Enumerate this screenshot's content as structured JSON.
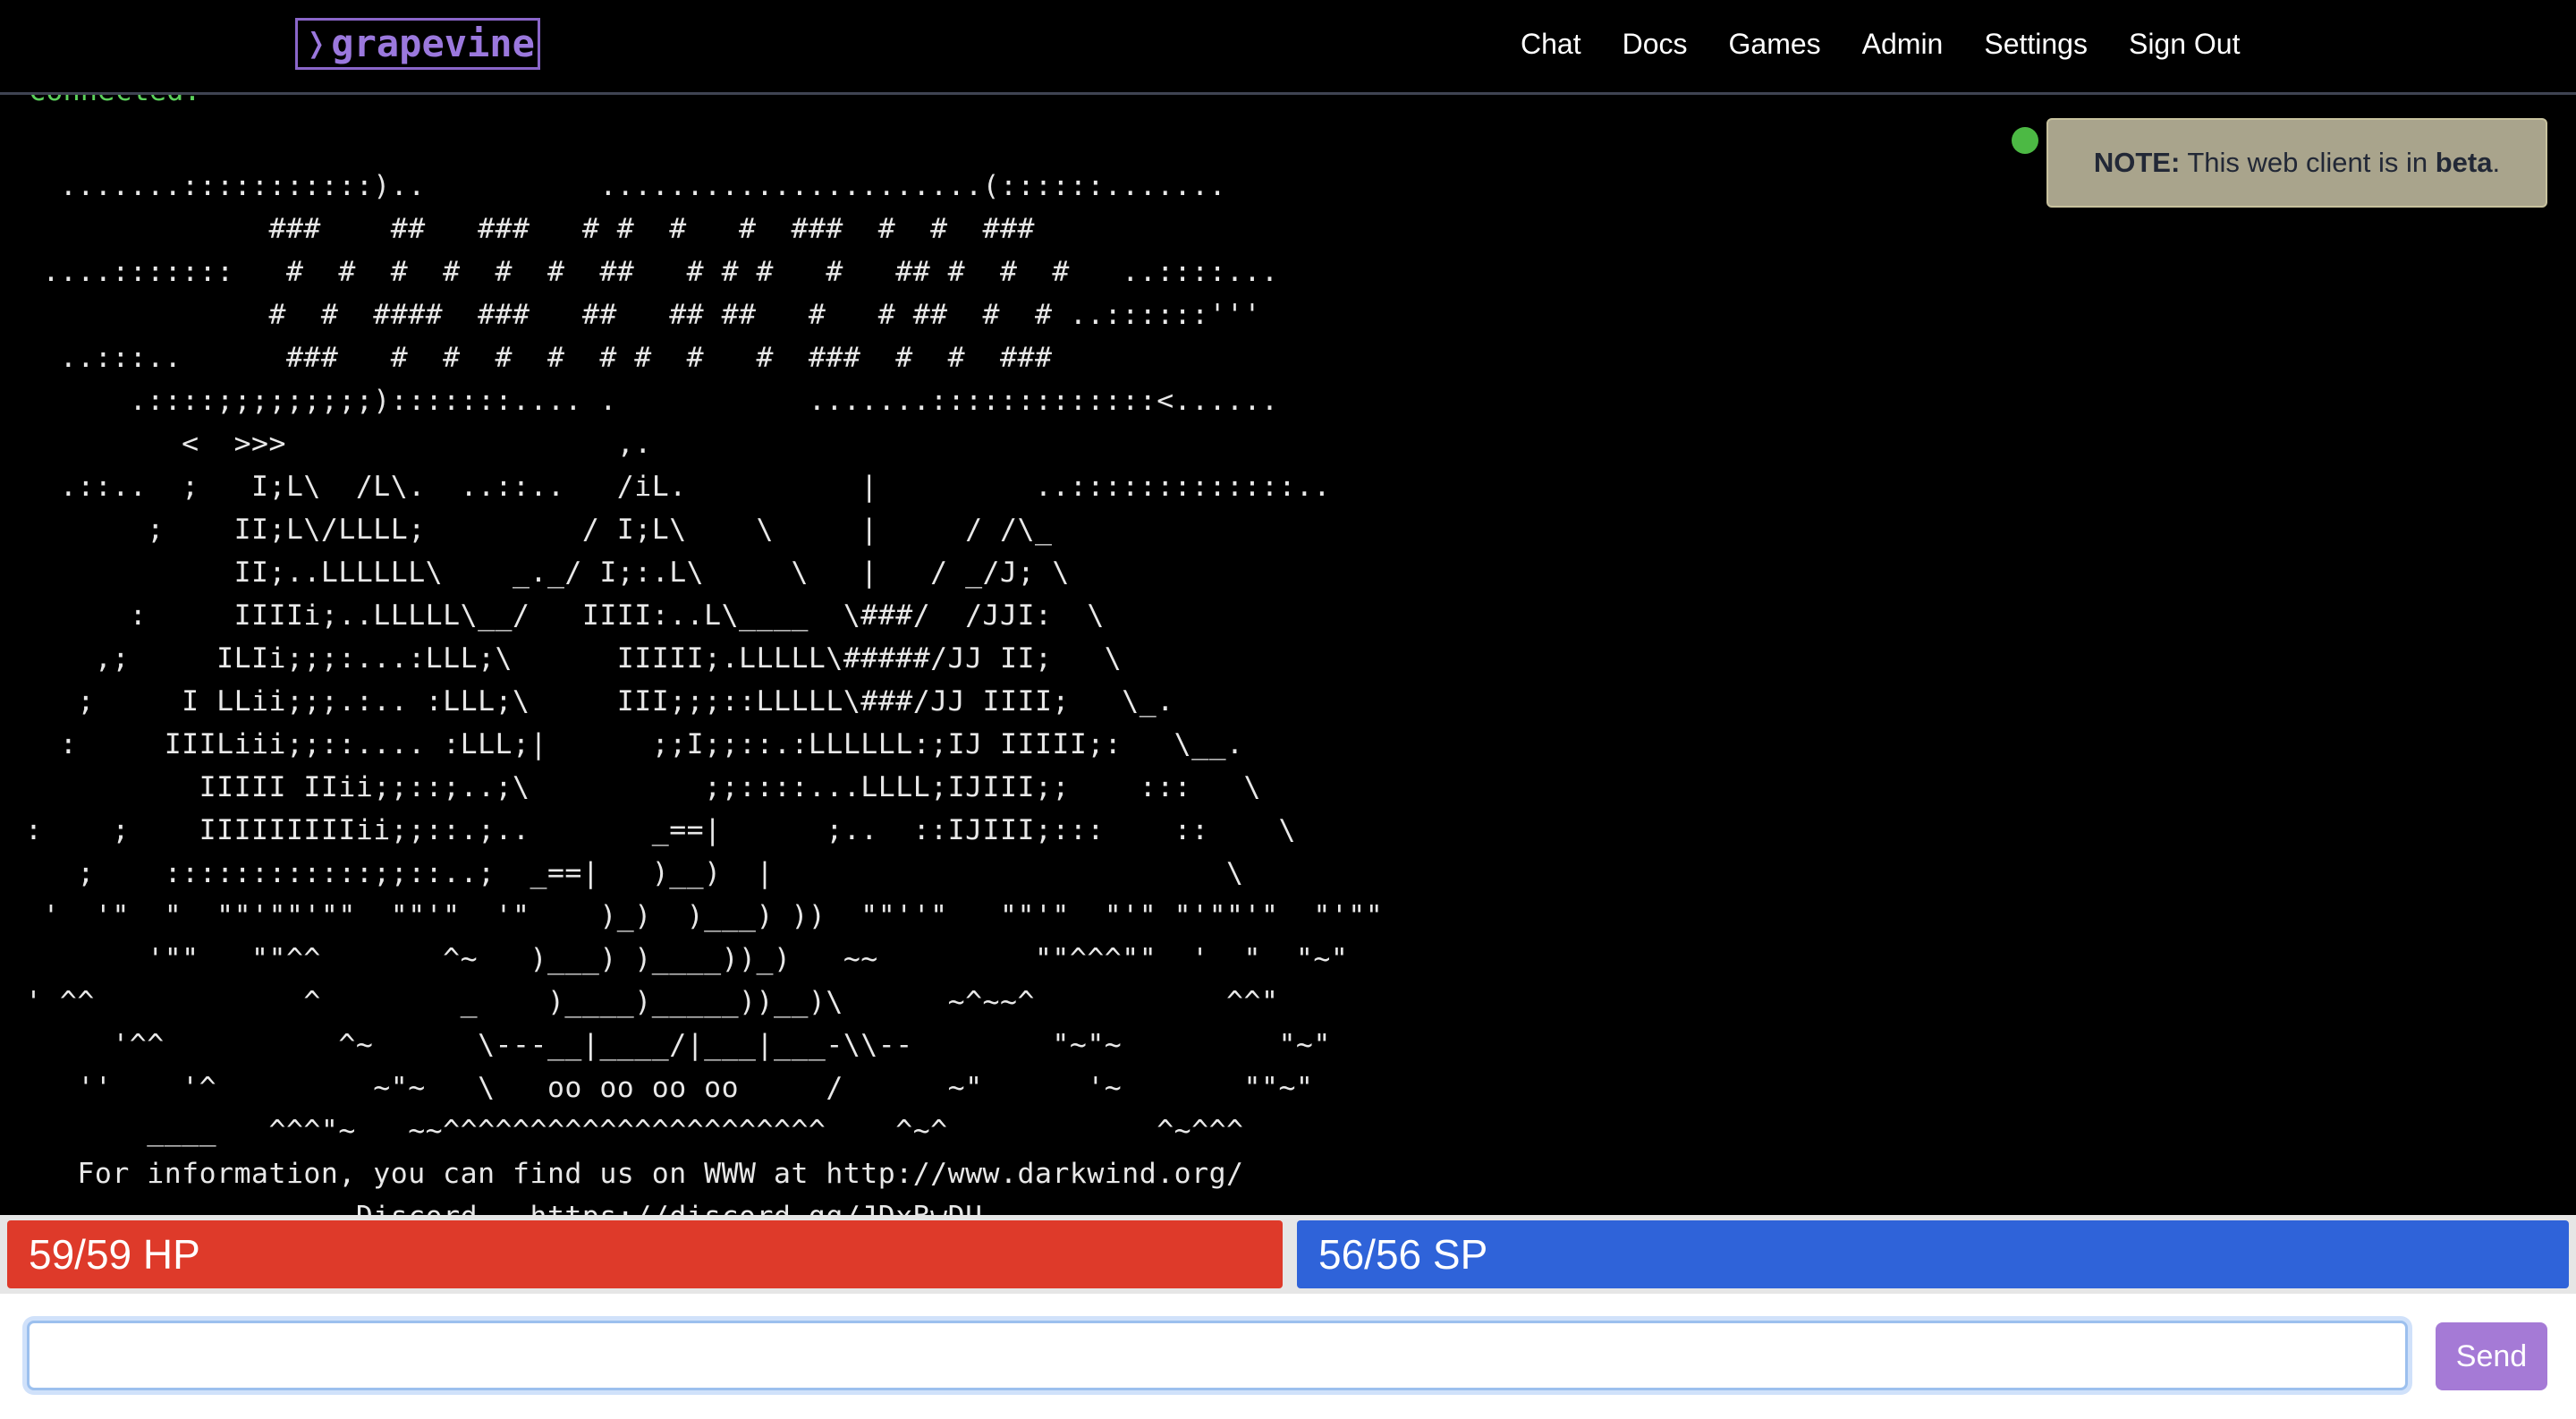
{
  "navbar": {
    "brand_chevron": "❭",
    "brand_text": "grapevine",
    "links": [
      "Chat",
      "Docs",
      "Games",
      "Admin",
      "Settings",
      "Sign Out"
    ]
  },
  "terminal": {
    "status_text": "Connected.",
    "ascii_art": "  .......:::::::::::)..          ......................(::::::.......\n              ###    ##   ###   # #  #   #  ###  #  #  ###\n ....:::::::   #  #  #  #  #  #  ##   # # #   #   ## #  #  #   ..::::...\n              #  #  ####  ###   ##   ## ##   #   # ##  #  # ..::::::'''\n  ..:::..      ###   #  #  #  #  # #  #   #  ###  #  #  ###\n      .::::;;;;;;;;;):::::::.... .           .......:::::::::::::<......\n         <  >>>                   ,.\n  .::..  ;   I;L\\  /L\\.  ..::..   /iL.          |         ..:::::::::::::..\n       ;    II;L\\/LLLL;         / I;L\\    \\     |     / /\\_\n            II;..LLLLLL\\    _._/ I;:.L\\     \\   |   / _/J; \\\n      :     IIIIi;..LLLLL\\__/   IIII:..L\\____  \\###/  /JJI:  \\\n    ,;     ILIi;;;:...:LLL;\\      IIIII;.LLLLL\\#####/JJ II;   \\\n   ;     I LLii;;;.:.. :LLL;\\     III;;;::LLLLL\\###/JJ IIII;   \\_.\n  :     IIILiii;;::.... :LLL;|      ;;I;;::.:LLLLLL:;IJ IIIII;:   \\__.\n          IIIII IIii;;::;..;\\          ;;::::...LLLL;IJIII;;    :::   \\\n:    ;    IIIIIIIIIii;;::.;..       _==|      ;..  ::IJIII;:::    ::    \\\n   ;    ::::::::::::;;::..;  _==|   )__)  |                          \\\n '  '\"  \"  \"\"'\"\"'\"\"  \"\"'\"  '\"    )_)  )___) ))  \"\"''\"   \"\"'\"  \"'\" \"'\"\"'\"  \"'\"\"\n       '\"\"   \"\"^^       ^~   )___) )____))_)   ~~         \"\"^^^\"\"  '  \"  \"~\"\n' ^^            ^        _    )____)_____))__)\\      ~^~~^           ^^\"\n     '^^          ^~      \\---__|____/|___|___-\\\\--        \"~\"~         \"~\"\n   ''    '^         ~\"~   \\   oo oo oo oo     /      ~\"      '~       \"\"~\"\n       ____   ^^^\"~   ~~^^^^^^^^^^^^^^^^^^^^^^    ^~^            ^~^^^\n   For information, you can find us on WWW at http://www.darkwind.org/\n                   Discord - https://discord.gg/JDxBwDU"
  },
  "notice": {
    "label": "NOTE:",
    "text_before": " This web client is in ",
    "emphasis": "beta",
    "text_after": "."
  },
  "vitals": {
    "hp_text": "59/59 HP",
    "hp_fraction": 1.0,
    "sp_text": "56/56 SP",
    "sp_fraction": 1.0,
    "hp_color": "#de3a2a",
    "sp_color": "#2f63d9"
  },
  "input": {
    "value": "",
    "placeholder": "",
    "send_label": "Send"
  },
  "colors": {
    "brand": "#9b78dd",
    "status_connected": "#5bd15b",
    "online_indicator": "#4cb944",
    "send_button": "#a57ad6"
  }
}
